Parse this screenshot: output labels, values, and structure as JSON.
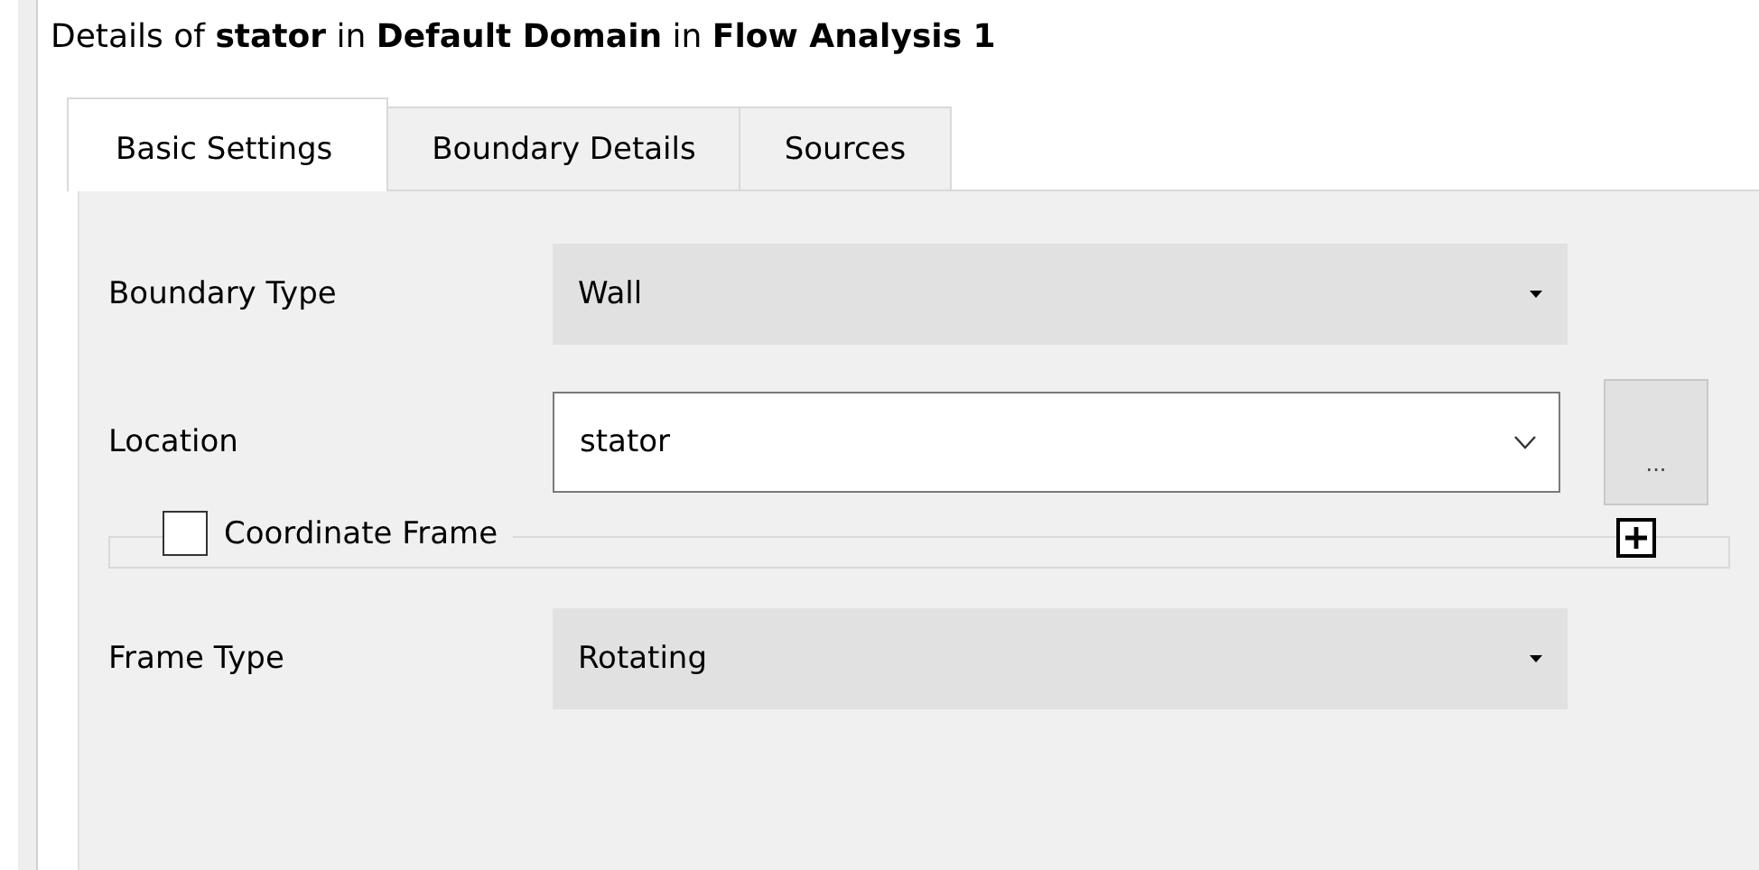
{
  "title": "Details of **stator** in **Default Domain** in **Flow Analysis 1**",
  "tabs": [
    {
      "label": "Basic Settings",
      "selected": true
    },
    {
      "label": "Boundary Details",
      "selected": false
    },
    {
      "label": "Sources",
      "selected": false
    }
  ],
  "fields": [
    {
      "kind": "dropdown",
      "label": "Boundary Type",
      "value": "Wall"
    },
    {
      "kind": "combo",
      "label": "Location",
      "value": "stator",
      "button": "..."
    },
    {
      "kind": "group",
      "label": "Coordinate Frame",
      "checked": false,
      "expanded": false
    },
    {
      "kind": "dropdown",
      "label": "Frame Type",
      "value": "Rotating"
    }
  ]
}
